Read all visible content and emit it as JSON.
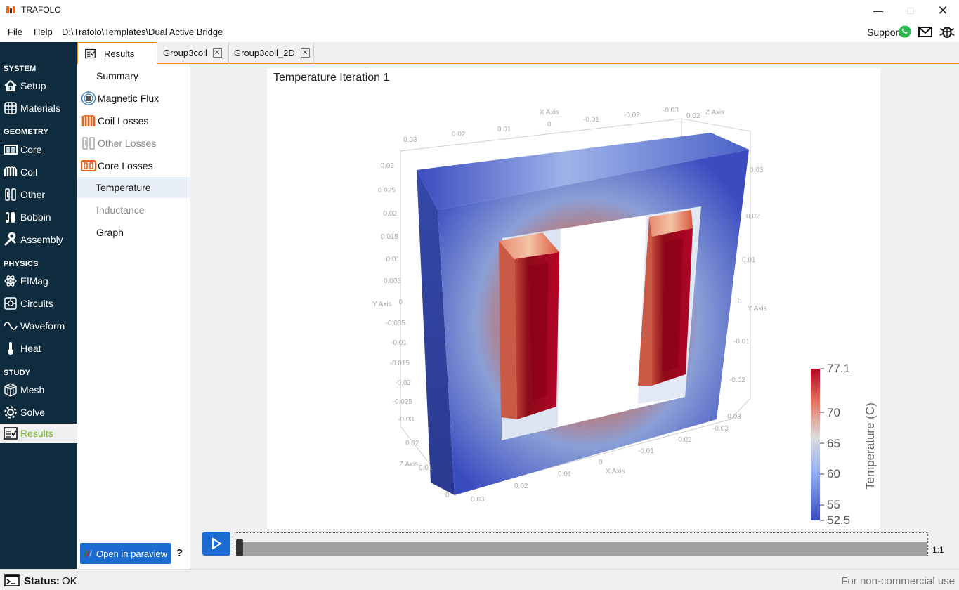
{
  "window": {
    "title": "TRAFOLO"
  },
  "menu": {
    "file": "File",
    "help": "Help",
    "path": "D:\\Trafolo\\Templates\\Dual Active Bridge",
    "support": "Support:"
  },
  "nav": {
    "sections": {
      "system": "SYSTEM",
      "geometry": "GEOMETRY",
      "physics": "PHYSICS",
      "study": "STUDY"
    },
    "items": {
      "setup": "Setup",
      "materials": "Materials",
      "core": "Core",
      "coil": "Coil",
      "other": "Other",
      "bobbin": "Bobbin",
      "assembly": "Assembly",
      "elmag": "ElMag",
      "circuits": "Circuits",
      "waveform": "Waveform",
      "heat": "Heat",
      "mesh": "Mesh",
      "solve": "Solve",
      "results": "Results"
    }
  },
  "tabs": [
    "Results",
    "Group3coil",
    "Group3coil_2D"
  ],
  "results_menu": [
    "Summary",
    "Magnetic Flux",
    "Coil Losses",
    "Other Losses",
    "Core Losses",
    "Temperature",
    "Inductance",
    "Graph"
  ],
  "paraview": {
    "label": "Open in paraview",
    "help": "?"
  },
  "viewer": {
    "title": "Temperature Iteration 1",
    "axes": {
      "x_axis_label": "X Axis",
      "y_axis_label": "Y Axis",
      "z_axis_label": "Z Axis",
      "top_ticks": [
        "0.03",
        "0.02",
        "0.01",
        "0",
        "-0.01",
        "-0.02",
        "-0.03",
        "0.02"
      ],
      "left_ticks": [
        "0.03",
        "0.025",
        "0.02",
        "0.015",
        "0.01",
        "0.005",
        "0",
        "-0.005",
        "-0.01",
        "-0.015",
        "-0.02",
        "-0.025",
        "-0.03"
      ],
      "right_ticks": [
        "0.03",
        "0.02",
        "0.01",
        "0",
        "-0.01",
        "-0.02",
        "-0.03"
      ],
      "bottom_ticks": [
        "0.03",
        "0.02",
        "0.01",
        "0",
        "-0.01",
        "-0.02",
        "-0.03"
      ],
      "z_ticks": [
        "0.02",
        "0.01",
        "0"
      ]
    },
    "colorbar": {
      "title": "Temperature (C)",
      "ticks": [
        "77.1",
        "70",
        "65",
        "60",
        "55",
        "52.5"
      ],
      "min": 52.5,
      "max": 77.1
    },
    "colors": {
      "cold": "#3b4cc0",
      "mid": "#dddddd",
      "hot": "#b40426"
    }
  },
  "playback": {
    "frame_ratio": "1:1",
    "progress": 0
  },
  "status": {
    "label": "Status:",
    "value": "OK",
    "license": "For non-commercial use"
  },
  "colors": {
    "nav_bg": "#0f2c3e",
    "accent": "#1b6bd0",
    "tab_border": "#e08a2c",
    "results_active": "#7ab52a"
  }
}
